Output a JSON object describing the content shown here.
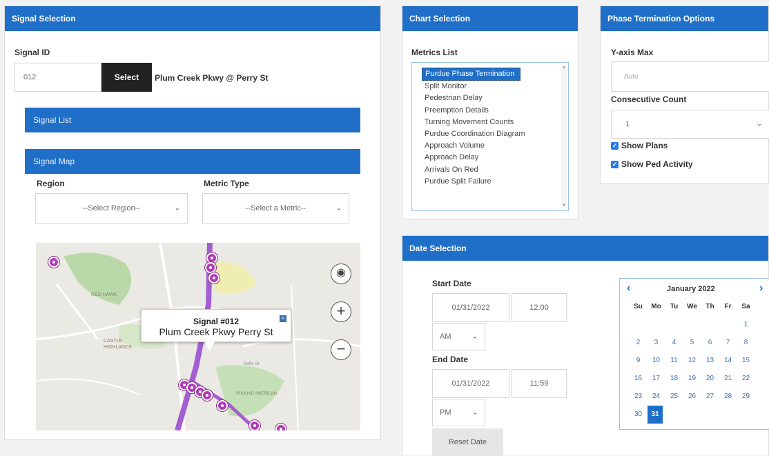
{
  "signal_selection": {
    "header": "Signal Selection",
    "signal_id_label": "Signal ID",
    "signal_id_value": "012",
    "select_button": "Select",
    "signal_name": "Plum Creek Pkwy @ Perry St",
    "signal_list_header": "Signal List",
    "signal_map_header": "Signal Map",
    "region_label": "Region",
    "region_value": "--Select Region--",
    "metric_type_label": "Metric Type",
    "metric_type_value": "--Select a Metric--",
    "map": {
      "popup_title": "Signal #012",
      "popup_subtitle": "Plum Creek Pkwy Perry St",
      "place_labels": [
        "RED HAWK",
        "CASTLE HIGHLANDS",
        "PHOUND AMERICAN",
        "Salix St"
      ],
      "controls": [
        "locate-icon",
        "zoom-in-icon",
        "zoom-out-icon"
      ]
    }
  },
  "chart_selection": {
    "header": "Chart Selection",
    "metrics_label": "Metrics List",
    "metrics": [
      "Purdue Phase Termination",
      "Split Monitor",
      "Pedestrian Delay",
      "Preemption Details",
      "Turning Movement Counts",
      "Purdue Coordination Diagram",
      "Approach Volume",
      "Approach Delay",
      "Arrivals On Red",
      "Purdue Split Failure"
    ],
    "selected_metric": "Purdue Phase Termination"
  },
  "phase_options": {
    "header": "Phase Termination Options",
    "yaxis_label": "Y-axis Max",
    "yaxis_placeholder": "Auto",
    "consecutive_label": "Consecutive Count",
    "consecutive_value": "1",
    "show_plans": "Show Plans",
    "show_ped": "Show Ped Activity"
  },
  "date_selection": {
    "header": "Date Selection",
    "start_label": "Start Date",
    "start_date": "01/31/2022",
    "start_time": "12:00",
    "start_ampm": "AM",
    "end_label": "End Date",
    "end_date": "01/31/2022",
    "end_time": "11:59",
    "end_ampm": "PM",
    "reset_button": "Reset Date",
    "calendar": {
      "month": "January 2022",
      "days": [
        "Su",
        "Mo",
        "Tu",
        "We",
        "Th",
        "Fr",
        "Sa"
      ],
      "weeks": [
        [
          "",
          "",
          "",
          "",
          "",
          "",
          "1"
        ],
        [
          "2",
          "3",
          "4",
          "5",
          "6",
          "7",
          "8"
        ],
        [
          "9",
          "10",
          "11",
          "12",
          "13",
          "14",
          "15"
        ],
        [
          "16",
          "17",
          "18",
          "19",
          "20",
          "21",
          "22"
        ],
        [
          "23",
          "24",
          "25",
          "26",
          "27",
          "28",
          "29"
        ],
        [
          "30",
          "31",
          "",
          "",
          "",
          "",
          ""
        ]
      ],
      "selected_day": "31",
      "prev_icon": "chevron-left-icon",
      "next_icon": "chevron-right-icon"
    }
  },
  "colors": {
    "header_blue": "#1f6fc8",
    "pin_purple": "#b13cb8",
    "road_purple": "#a35fd1"
  }
}
